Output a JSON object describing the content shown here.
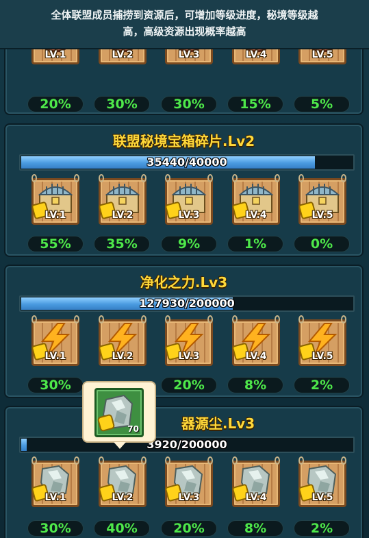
{
  "notice": {
    "line1": "全体联盟成员捕捞到资源后，可增加等级进度，秘境等级越",
    "line2": "高，高级资源出现概率越高"
  },
  "sections": [
    {
      "id": "turtle",
      "title": "",
      "levels": [
        "LV.1",
        "LV.2",
        "LV.3",
        "LV.4",
        "LV.5"
      ],
      "percents": [
        "20%",
        "30%",
        "30%",
        "15%",
        "5%"
      ],
      "icon": "turtle-shell-icon"
    },
    {
      "id": "chest",
      "title": "联盟秘境宝箱碎片.Lv2",
      "progress_text": "35440/40000",
      "progress": 0.886,
      "levels": [
        "LV.1",
        "LV.2",
        "LV.3",
        "LV.4",
        "LV.5"
      ],
      "percents": [
        "55%",
        "35%",
        "9%",
        "1%",
        "0%"
      ],
      "icon": "treasure-chest-icon"
    },
    {
      "id": "purify",
      "title": "净化之力.Lv3",
      "progress_text": "127930/200000",
      "progress": 0.64,
      "levels": [
        "LV.1",
        "LV.2",
        "LV.3",
        "LV.4",
        "LV.5"
      ],
      "percents": [
        "30%",
        "",
        "20%",
        "8%",
        "2%"
      ],
      "icon": "lightning-icon"
    },
    {
      "id": "dust",
      "title": "器源尘.Lv3",
      "progress_text": "3920/200000",
      "progress": 0.0196,
      "levels": [
        "LV.1",
        "LV.2",
        "LV.3",
        "LV.4",
        "LV.5"
      ],
      "percents": [
        "30%",
        "40%",
        "20%",
        "8%",
        "2%"
      ],
      "icon": "crystal-shard-icon"
    }
  ],
  "tooltip": {
    "count": "70",
    "icon": "crystal-shard-icon"
  },
  "colors": {
    "title": "#ffd93a",
    "percent": "#4ee84a",
    "bar": "#4a9be0"
  }
}
